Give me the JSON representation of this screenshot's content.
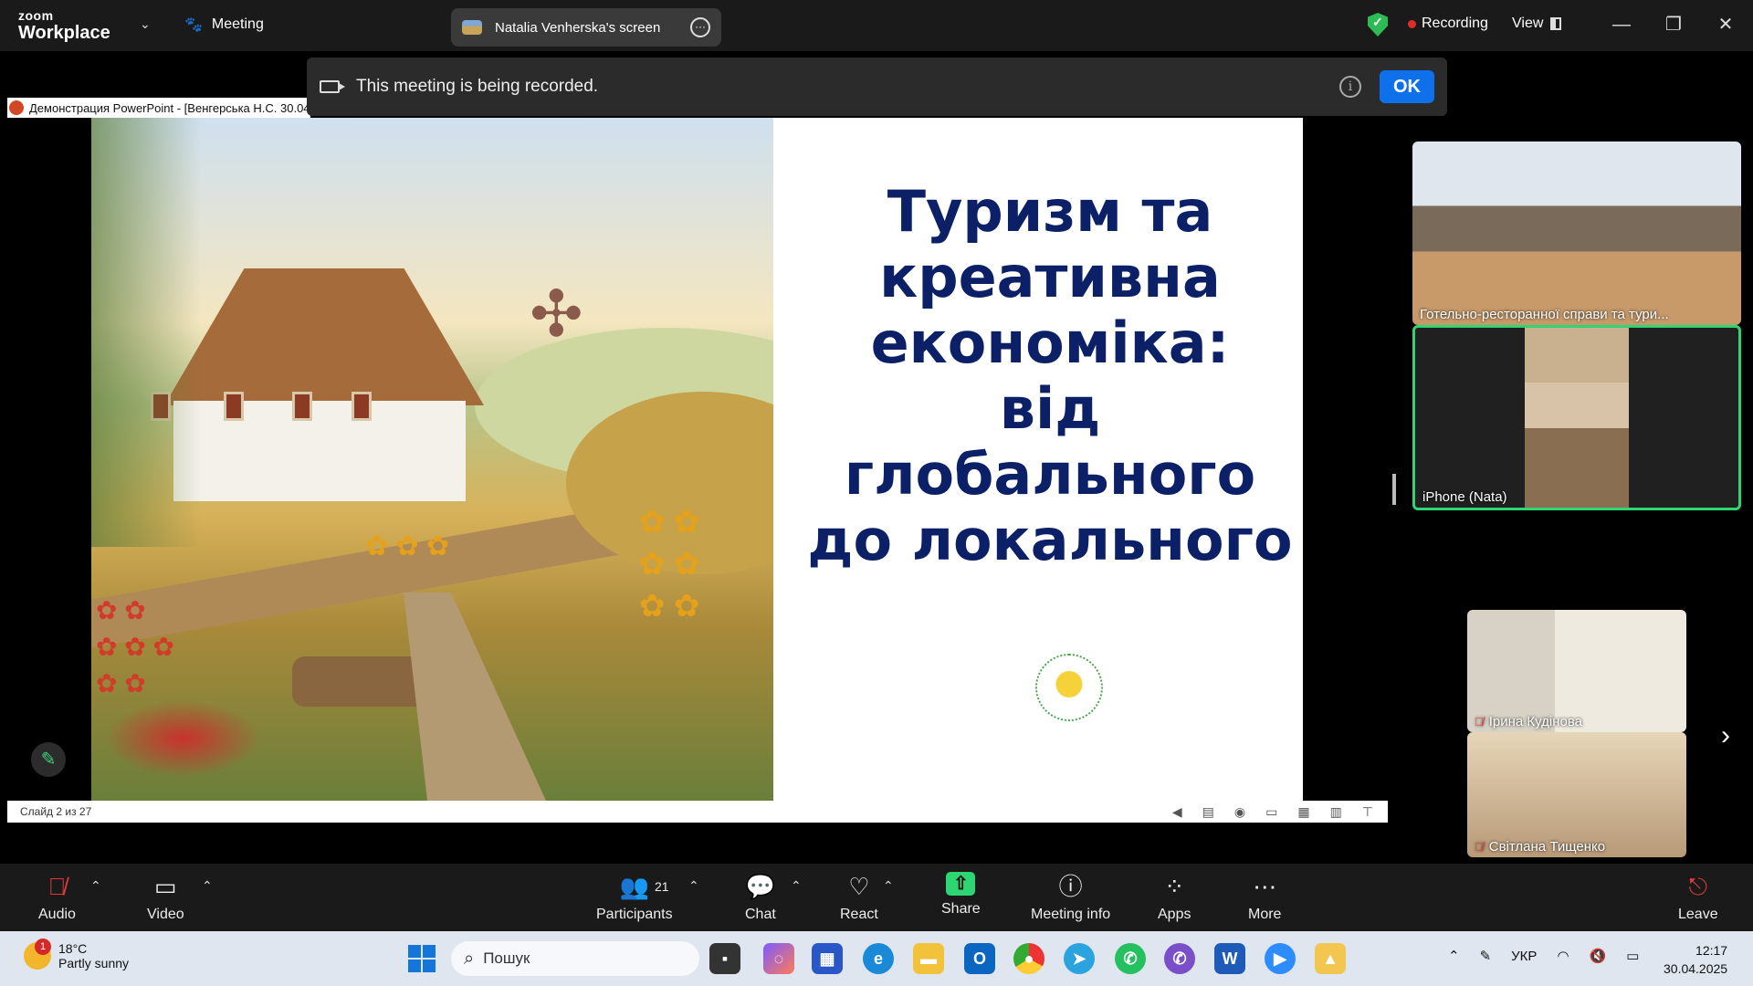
{
  "app": {
    "brand_small": "zoom",
    "brand_large": "Workplace",
    "meeting_label": "Meeting"
  },
  "screen_share": {
    "label": "Natalia Venherska's screen"
  },
  "status": {
    "recording_label": "Recording",
    "view_label": "View"
  },
  "notification": {
    "text": "This meeting is being recorded.",
    "ok_label": "OK"
  },
  "presentation": {
    "window_title": "Демонстрация PowerPoint - [Венгерська Н.С. 30.04",
    "slide_title_lines": [
      "Туризм та",
      "креативна",
      "економіка:",
      "від",
      "глобального",
      "до локального"
    ],
    "slide_counter": "Слайд 2 из 27"
  },
  "participants_tiles": [
    {
      "name": "Готельно-ресторанної справи та тури...",
      "muted": false
    },
    {
      "name": "iPhone (Nata)",
      "muted": false
    },
    {
      "name": "Ірина  Кудінова",
      "muted": true
    },
    {
      "name": "Світлана Тищенко",
      "muted": true
    }
  ],
  "toolbar": {
    "audio": "Audio",
    "video": "Video",
    "participants": "Participants",
    "participants_count": "21",
    "chat": "Chat",
    "react": "React",
    "share": "Share",
    "meeting_info": "Meeting info",
    "apps": "Apps",
    "more": "More",
    "leave": "Leave"
  },
  "taskbar": {
    "weather_temp": "18°C",
    "weather_desc": "Partly sunny",
    "weather_badge": "1",
    "search_placeholder": "Пошук",
    "language": "УКР",
    "time": "12:17",
    "date": "30.04.2025"
  },
  "colors": {
    "accent_blue": "#0e71eb",
    "active_green": "#2ed573",
    "recording_red": "#e02b2b",
    "slide_title": "#0b2066"
  }
}
